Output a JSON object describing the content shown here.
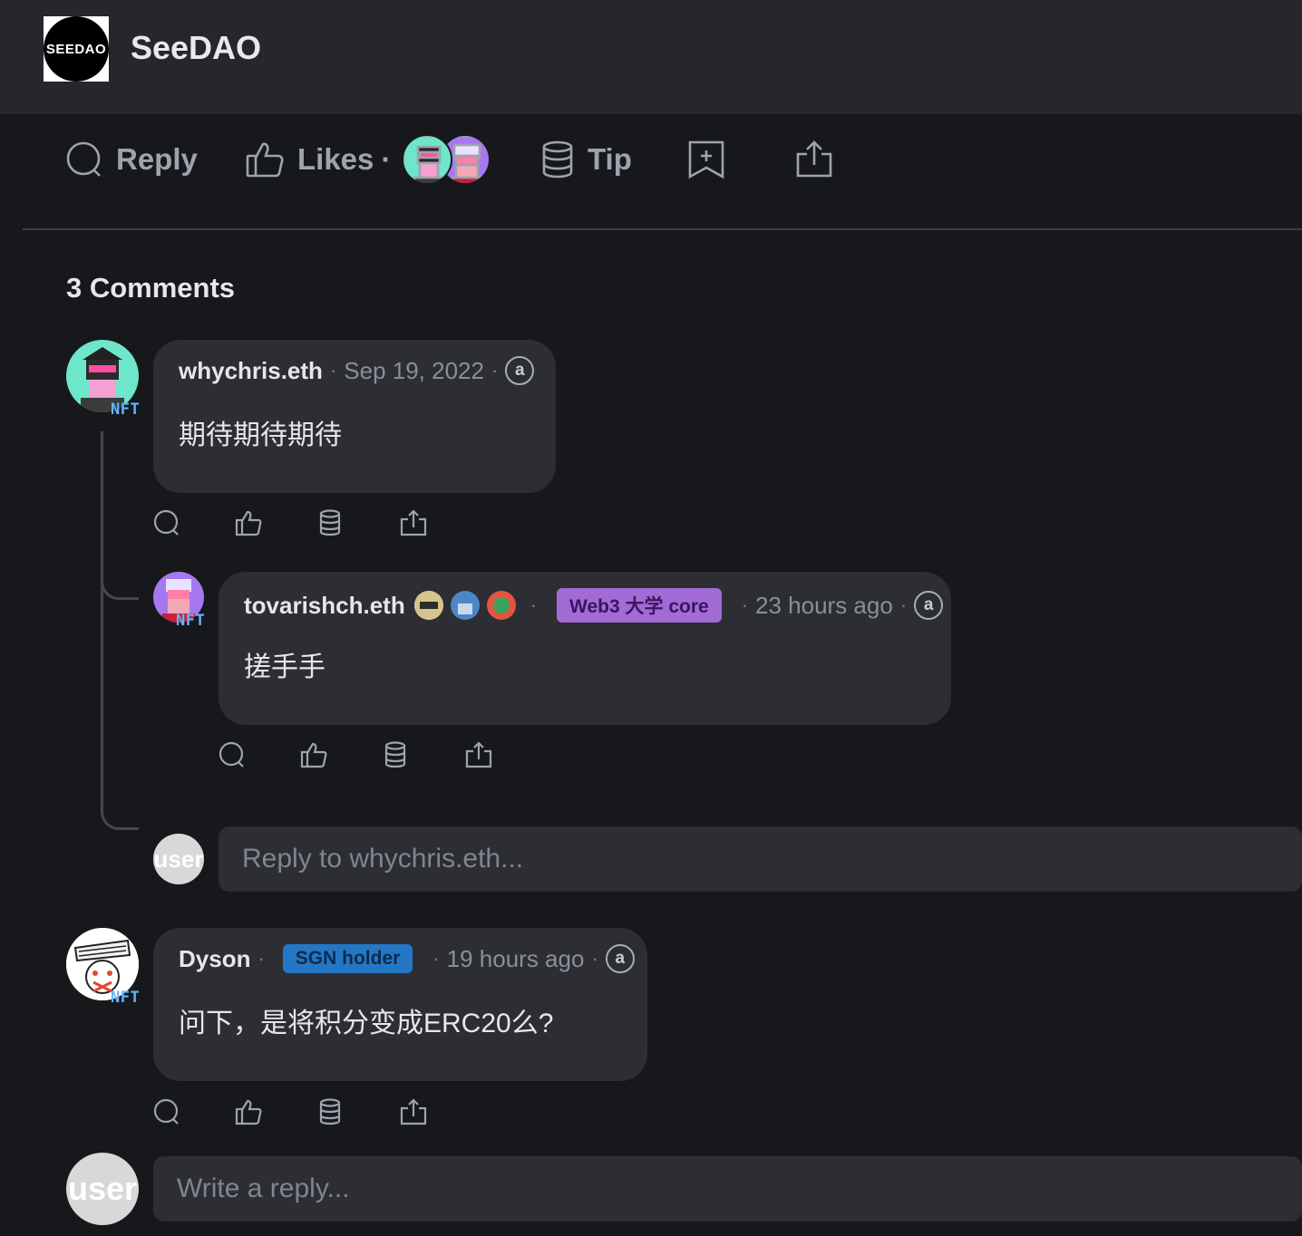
{
  "header": {
    "logo_text": "SEEDAO",
    "title": "SeeDAO"
  },
  "post_actions": {
    "reply_label": "Reply",
    "likes_label": "Likes",
    "dot": "·",
    "tip_label": "Tip"
  },
  "comments_heading": "3 Comments",
  "comments": [
    {
      "author": "whychris.eth",
      "date": "Sep 19, 2022",
      "body": "期待期待期待",
      "nft": "NFT",
      "at": "a",
      "replies": [
        {
          "author": "tovarishch.eth",
          "badge": "Web3 大学 core",
          "date": "23 hours ago",
          "body": "搓手手",
          "nft": "NFT",
          "at": "a"
        }
      ],
      "reply_placeholder": "Reply to whychris.eth..."
    },
    {
      "author": "Dyson",
      "badge": "SGN holder",
      "date": "19 hours ago",
      "body": "问下，是将积分变成ERC20么?",
      "nft": "NFT",
      "at": "a"
    }
  ],
  "user_avatar_label": "user",
  "write_reply_placeholder": "Write a reply...",
  "colors": {
    "badge_purple": "#a36bd5",
    "badge_blue": "#2377c5",
    "background": "#17181b",
    "bubble": "#2c2e33"
  },
  "icons": [
    "reply-icon",
    "like-icon",
    "tip-icon",
    "bookmark-icon",
    "share-icon",
    "at-icon"
  ]
}
